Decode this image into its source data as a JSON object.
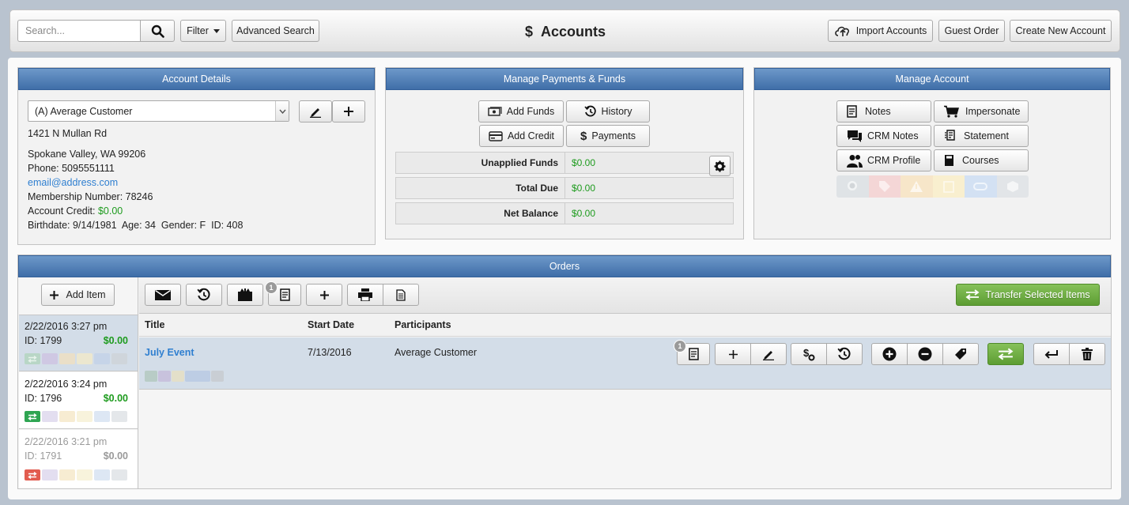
{
  "header": {
    "search_placeholder": "Search...",
    "filter_label": "Filter",
    "advanced_search_label": "Advanced Search",
    "title_symbol": "$",
    "title": "Accounts",
    "import_label": "Import Accounts",
    "guest_order_label": "Guest Order",
    "create_label": "Create New Account"
  },
  "account_details": {
    "header": "Account Details",
    "selected_account": "(A) Average Customer",
    "address1": "1421 N Mullan Rd",
    "address2": "Spokane Valley, WA 99206",
    "phone": "Phone: 5095551111",
    "email": "email@address.com",
    "membership": "Membership Number: 78246",
    "credit_label": "Account Credit:",
    "credit_value": "$0.00",
    "birthdate_line": "Birthdate: 9/14/1981  Age: 34  Gender: F  ID: 408"
  },
  "payments": {
    "header": "Manage Payments & Funds",
    "add_funds": "Add Funds",
    "history": "History",
    "add_credit": "Add Credit",
    "payments": "Payments",
    "rows": [
      {
        "label": "Unapplied Funds",
        "value": "$0.00"
      },
      {
        "label": "Total Due",
        "value": "$0.00"
      },
      {
        "label": "Net Balance",
        "value": "$0.00"
      }
    ]
  },
  "manage": {
    "header": "Manage Account",
    "notes": "Notes",
    "impersonate": "Impersonate",
    "crm_notes": "CRM Notes",
    "statement": "Statement",
    "crm_profile": "CRM Profile",
    "courses": "Courses"
  },
  "orders": {
    "header": "Orders",
    "add_item": "Add Item",
    "transfer_label": "Transfer Selected Items",
    "notes_count": "1",
    "columns": {
      "title": "Title",
      "start_date": "Start Date",
      "participants": "Participants"
    },
    "list": [
      {
        "date": "2/22/2016 3:27 pm",
        "id": "ID: 1799",
        "amount": "$0.00"
      },
      {
        "date": "2/22/2016 3:24 pm",
        "id": "ID: 1796",
        "amount": "$0.00"
      },
      {
        "date": "2/22/2016 3:21 pm",
        "id": "ID: 1791",
        "amount": "$0.00"
      }
    ],
    "item": {
      "title": "July Event",
      "start_date": "7/13/2016",
      "participants": "Average Customer",
      "notes_count": "1"
    }
  },
  "colors": {
    "accent": "#4a78b0",
    "green_button": "#6fb041",
    "money": "#1e9b1e",
    "link": "#2f7fd0"
  }
}
